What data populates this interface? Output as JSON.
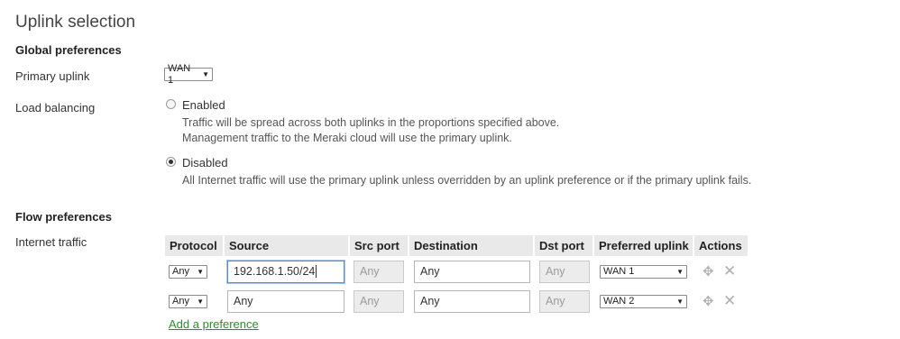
{
  "page": {
    "title": "Uplink selection"
  },
  "global": {
    "heading": "Global preferences",
    "primary_uplink": {
      "label": "Primary uplink",
      "value": "WAN 1"
    },
    "load_balancing": {
      "label": "Load balancing",
      "enabled": {
        "label": "Enabled",
        "desc1": "Traffic will be spread across both uplinks in the proportions specified above.",
        "desc2": "Management traffic to the Meraki cloud will use the primary uplink."
      },
      "disabled": {
        "label": "Disabled",
        "desc": "All Internet traffic will use the primary uplink unless overridden by an uplink preference or if the primary uplink fails."
      },
      "selected": "Disabled"
    }
  },
  "flow": {
    "heading": "Flow preferences",
    "internet_label": "Internet traffic",
    "columns": [
      "Protocol",
      "Source",
      "Src port",
      "Destination",
      "Dst port",
      "Preferred uplink",
      "Actions"
    ],
    "rows": [
      {
        "protocol": "Any",
        "source": "192.168.1.50/24",
        "src_port": "Any",
        "destination": "Any",
        "dst_port": "Any",
        "uplink": "WAN 1"
      },
      {
        "protocol": "Any",
        "source": "Any",
        "src_port": "Any",
        "destination": "Any",
        "dst_port": "Any",
        "uplink": "WAN 2"
      }
    ],
    "add_link": "Add a preference"
  },
  "icons": {
    "move": "move-icon",
    "delete": "close-icon"
  },
  "colors": {
    "link": "#2e8b2e",
    "header_bg": "#e9e9e9",
    "focus": "#5b8ad6"
  }
}
